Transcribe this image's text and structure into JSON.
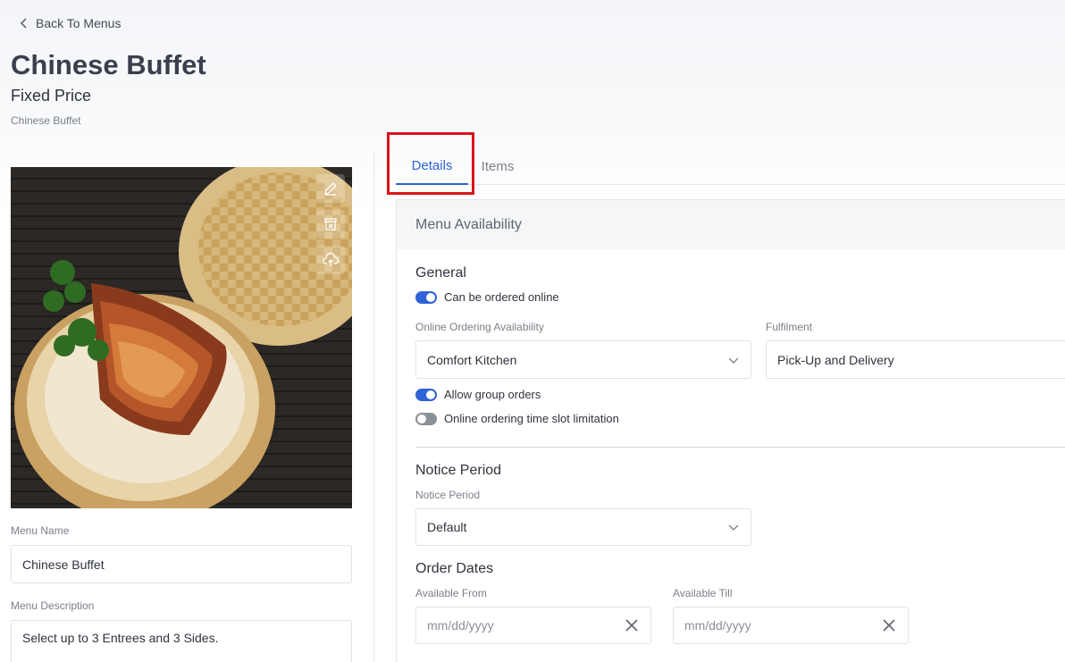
{
  "nav": {
    "back_label": "Back To Menus"
  },
  "header": {
    "title": "Chinese Buffet",
    "subtitle": "Fixed Price",
    "caption": "Chinese Buffet"
  },
  "left": {
    "menu_name_label": "Menu Name",
    "menu_name_value": "Chinese Buffet",
    "menu_description_label": "Menu Description",
    "menu_description_value": "Select up to 3 Entrees and 3 Sides.",
    "image_tools": [
      "pencil-icon",
      "delete-icon",
      "cloud-upload-icon"
    ]
  },
  "tabs": [
    {
      "label": "Details",
      "active": true
    },
    {
      "label": "Items",
      "active": false
    }
  ],
  "panel": {
    "header": "Menu Availability",
    "general": {
      "title": "General",
      "ordered_online_label": "Can be ordered online",
      "ordered_online": true,
      "availability_label": "Online Ordering Availability",
      "availability_value": "Comfort Kitchen",
      "fulfilment_label": "Fulfilment",
      "fulfilment_value": "Pick-Up and Delivery",
      "group_orders_label": "Allow group orders",
      "group_orders": true,
      "time_slot_label": "Online ordering time slot limitation",
      "time_slot": false
    },
    "notice": {
      "title": "Notice Period",
      "field_label": "Notice Period",
      "value": "Default"
    },
    "order_dates": {
      "title": "Order Dates",
      "from_label": "Available From",
      "from_placeholder": "mm/dd/yyyy",
      "till_label": "Available Till",
      "till_placeholder": "mm/dd/yyyy"
    }
  },
  "colors": {
    "accent": "#2e63d6",
    "highlight": "#d9141a",
    "toggle_off": "#8b8f97"
  }
}
